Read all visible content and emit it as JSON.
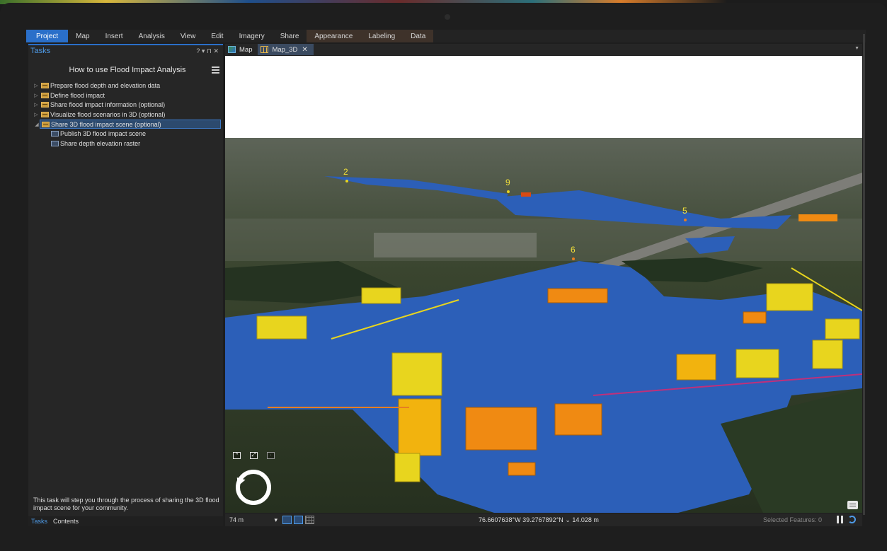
{
  "ribbon": {
    "tabs": [
      {
        "label": "Project",
        "active": true
      },
      {
        "label": "Map"
      },
      {
        "label": "Insert"
      },
      {
        "label": "Analysis"
      },
      {
        "label": "View"
      },
      {
        "label": "Edit"
      },
      {
        "label": "Imagery"
      },
      {
        "label": "Share"
      },
      {
        "label": "Appearance",
        "contextual": true
      },
      {
        "label": "Labeling",
        "contextual": true
      },
      {
        "label": "Data",
        "contextual": true
      }
    ]
  },
  "tasks_pane": {
    "title": "Tasks",
    "header_controls": "? ▾ ⊓ ✕",
    "task_name": "How to use Flood Impact Analysis",
    "tree": [
      {
        "label": "Prepare flood depth and elevation data",
        "type": "group",
        "expanded": false
      },
      {
        "label": "Define flood impact",
        "type": "group",
        "expanded": false
      },
      {
        "label": "Share flood impact information (optional)",
        "type": "group",
        "expanded": false
      },
      {
        "label": "Visualize flood scenarios in 3D (optional)",
        "type": "group",
        "expanded": false
      },
      {
        "label": "Share 3D flood impact scene (optional)",
        "type": "group",
        "expanded": true,
        "selected": true
      },
      {
        "label": "Publish 3D flood impact scene",
        "type": "step"
      },
      {
        "label": "Share depth elevation raster",
        "type": "step"
      }
    ],
    "description": "This task will step you through the process of sharing the 3D flood impact scene for your community.",
    "bottom_tabs": [
      {
        "label": "Tasks",
        "active": true
      },
      {
        "label": "Contents"
      }
    ]
  },
  "view_tabs": [
    {
      "label": "Map",
      "icon": "map-icon"
    },
    {
      "label": "Map_3D",
      "icon": "scene-icon",
      "active": true,
      "closable": true
    }
  ],
  "scene": {
    "markers": [
      "2",
      "9",
      "5",
      "6"
    ],
    "colors": {
      "sky": "#ffffff",
      "water": "#2c5fb8",
      "building_yellow": "#e8d51e",
      "building_orange": "#f08a12",
      "terrain": "#2f3a24"
    }
  },
  "status_bar": {
    "scale": "74 m",
    "coordinates": "76.6607638°W 39.2767892°N",
    "elevation": "14.028 m",
    "selected_features": "Selected Features: 0"
  }
}
